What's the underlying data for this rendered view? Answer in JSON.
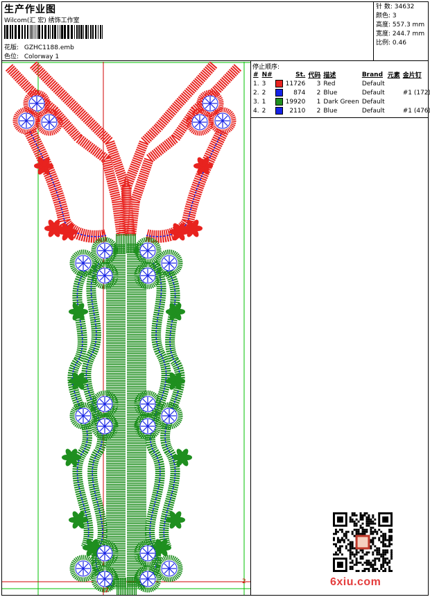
{
  "header": {
    "title": "生产作业图",
    "company": "Wilcom(汇 宏) 绣饰工作室",
    "pattern_label": "花版:",
    "pattern_value": "GZHC1188.emb",
    "colorway_label": "色位:",
    "colorway_value": "Colorway 1"
  },
  "stats": [
    {
      "label": "针 数:",
      "value": "34632"
    },
    {
      "label": "颜色:",
      "value": "3"
    },
    {
      "label": "高度:",
      "value": "557.3 mm"
    },
    {
      "label": "宽度:",
      "value": "244.7 mm"
    },
    {
      "label": "比例:",
      "value": "0.46"
    }
  ],
  "stop_sequence": {
    "heading": "停止顺序:",
    "columns": [
      "#",
      "N#",
      "",
      "St.",
      "代码",
      "描述",
      "Brand",
      "元素",
      "金片钉"
    ],
    "rows": [
      {
        "idx": "1.",
        "n": "3",
        "color": "#e8231f",
        "st": "11726",
        "code": "3",
        "desc": "Red",
        "brand": "Default",
        "elem": "",
        "seq": ""
      },
      {
        "idx": "2.",
        "n": "2",
        "color": "#1522e6",
        "st": "874",
        "code": "2",
        "desc": "Blue",
        "brand": "Default",
        "elem": "",
        "seq": "#1 (172)"
      },
      {
        "idx": "3.",
        "n": "1",
        "color": "#1f8f1f",
        "st": "19920",
        "code": "1",
        "desc": "Dark Green",
        "brand": "Default",
        "elem": "",
        "seq": ""
      },
      {
        "idx": "4.",
        "n": "2",
        "color": "#1522e6",
        "st": "2110",
        "code": "2",
        "desc": "Blue",
        "brand": "Default",
        "elem": "",
        "seq": "#1 (476)"
      }
    ]
  },
  "axis_markers": [
    "2",
    "2"
  ],
  "watermark": "6xiu.com",
  "colors": {
    "red": "#e8231f",
    "green": "#1f8f1f",
    "blue": "#1522e6",
    "guide_green": "#00c000",
    "guide_red": "#d00000"
  }
}
